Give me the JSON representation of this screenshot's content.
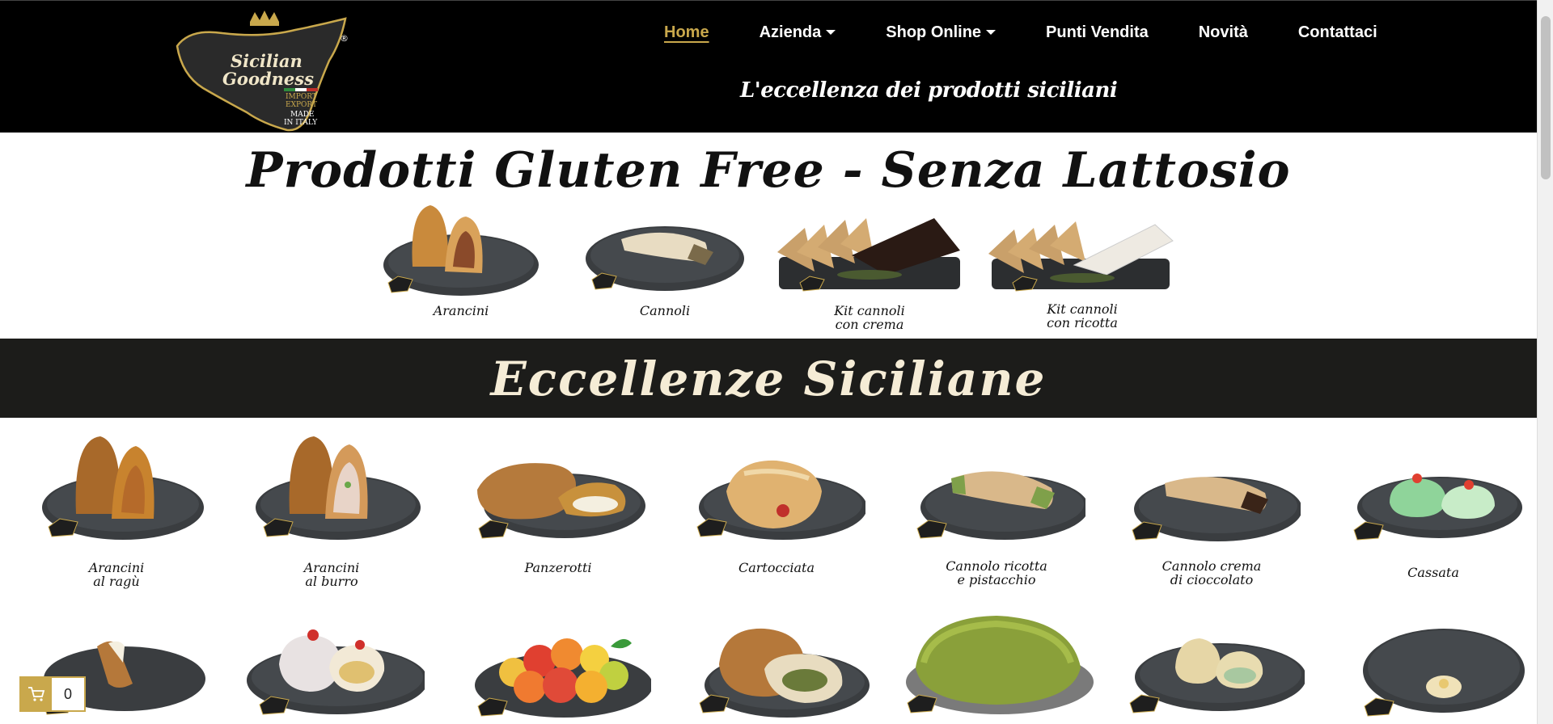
{
  "brand": {
    "logo_line1": "Sicilian",
    "logo_line2": "Goodness",
    "logo_line3": "IMPORT",
    "logo_line4": "EXPORT",
    "logo_line5": "MADE",
    "logo_line6": "IN ITALY",
    "registered": "®"
  },
  "nav": {
    "items": [
      {
        "label": "Home",
        "active": true,
        "dropdown": false
      },
      {
        "label": "Azienda",
        "active": false,
        "dropdown": true
      },
      {
        "label": "Shop Online",
        "active": false,
        "dropdown": true
      },
      {
        "label": "Punti Vendita",
        "active": false,
        "dropdown": false
      },
      {
        "label": "Novità",
        "active": false,
        "dropdown": false
      },
      {
        "label": "Contattaci",
        "active": false,
        "dropdown": false
      }
    ]
  },
  "tagline": "L'eccellenza dei prodotti siciliani",
  "gluten_free": {
    "title": "Prodotti Gluten Free - Senza Lattosio",
    "items": [
      {
        "label": "Arancini"
      },
      {
        "label": "Cannoli"
      },
      {
        "label_line1": "Kit cannoli",
        "label_line2": "con crema"
      },
      {
        "label_line1": "Kit cannoli",
        "label_line2": "con ricotta"
      }
    ]
  },
  "band": {
    "title": "Eccellenze Siciliane"
  },
  "products": [
    {
      "label_line1": "Arancini",
      "label_line2": "al ragù"
    },
    {
      "label_line1": "Arancini",
      "label_line2": "al burro"
    },
    {
      "label_line1": "Panzerotti",
      "label_line2": ""
    },
    {
      "label_line1": "Cartocciata",
      "label_line2": ""
    },
    {
      "label_line1": "Cannolo ricotta",
      "label_line2": "e pistacchio"
    },
    {
      "label_line1": "Cannolo crema",
      "label_line2": "di cioccolato"
    },
    {
      "label_line1": "Cassata",
      "label_line2": ""
    }
  ],
  "cart": {
    "count": "0"
  },
  "colors": {
    "accent_gold": "#c9a84c",
    "header_bg": "#000000",
    "band_bg": "#1c1c1a",
    "plate": "#3a3d40"
  }
}
